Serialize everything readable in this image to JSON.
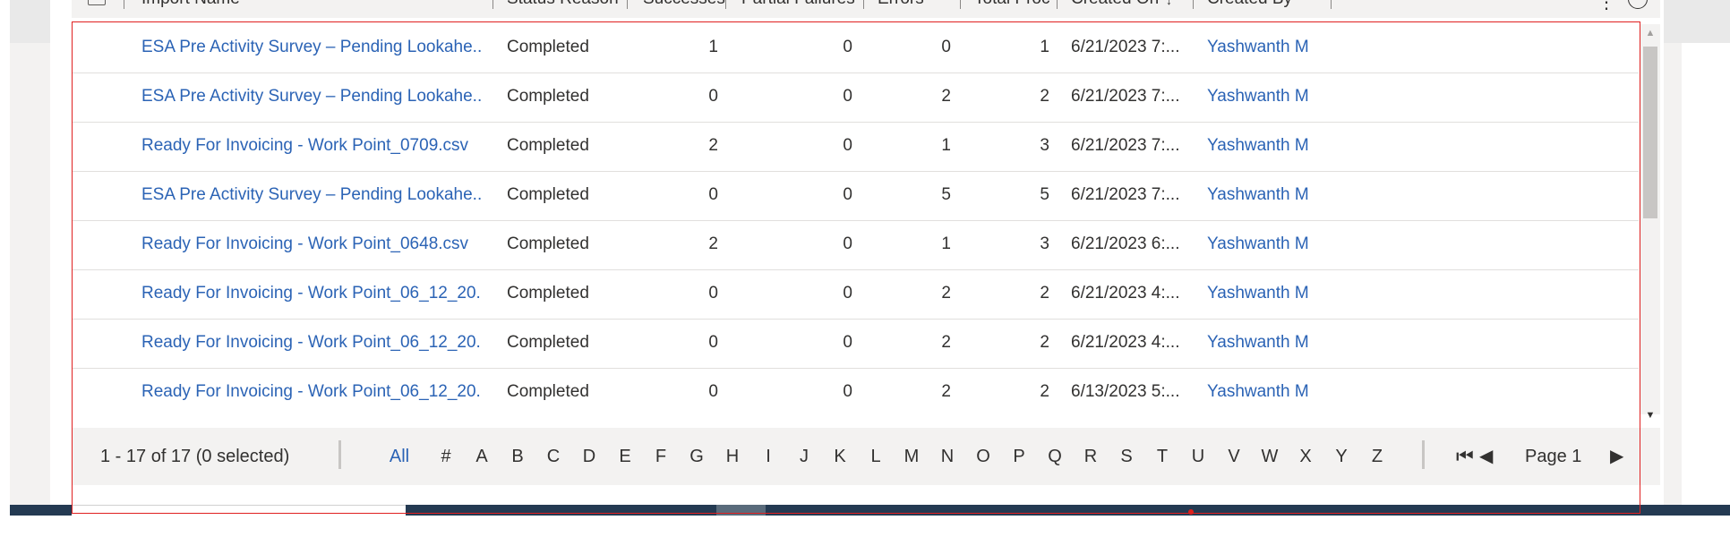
{
  "header": {
    "columns": [
      "Import Name",
      "Status Reason",
      "Successes",
      "Partial Failures",
      "Errors",
      "Total Proc",
      "Created On",
      "Created By"
    ]
  },
  "rows": [
    {
      "name": "ESA Pre Activity Survey – Pending Lookahe...",
      "status": "Completed",
      "successes": "1",
      "partial": "0",
      "errors": "0",
      "total": "1",
      "created_on": "6/21/2023 7:...",
      "created_by": "Yashwanth M"
    },
    {
      "name": "ESA Pre Activity Survey – Pending Lookahe...",
      "status": "Completed",
      "successes": "0",
      "partial": "0",
      "errors": "2",
      "total": "2",
      "created_on": "6/21/2023 7:...",
      "created_by": "Yashwanth M"
    },
    {
      "name": "Ready For Invoicing - Work Point_0709.csv",
      "status": "Completed",
      "successes": "2",
      "partial": "0",
      "errors": "1",
      "total": "3",
      "created_on": "6/21/2023 7:...",
      "created_by": "Yashwanth M"
    },
    {
      "name": "ESA Pre Activity Survey – Pending Lookahe...",
      "status": "Completed",
      "successes": "0",
      "partial": "0",
      "errors": "5",
      "total": "5",
      "created_on": "6/21/2023 7:...",
      "created_by": "Yashwanth M"
    },
    {
      "name": "Ready For Invoicing - Work Point_0648.csv",
      "status": "Completed",
      "successes": "2",
      "partial": "0",
      "errors": "1",
      "total": "3",
      "created_on": "6/21/2023 6:...",
      "created_by": "Yashwanth M"
    },
    {
      "name": "Ready For Invoicing - Work Point_06_12_20...",
      "status": "Completed",
      "successes": "0",
      "partial": "0",
      "errors": "2",
      "total": "2",
      "created_on": "6/21/2023 4:...",
      "created_by": "Yashwanth M"
    },
    {
      "name": "Ready For Invoicing - Work Point_06_12_20...",
      "status": "Completed",
      "successes": "0",
      "partial": "0",
      "errors": "2",
      "total": "2",
      "created_on": "6/21/2023 4:...",
      "created_by": "Yashwanth M"
    },
    {
      "name": "Ready For Invoicing - Work Point_06_12_20...",
      "status": "Completed",
      "successes": "0",
      "partial": "0",
      "errors": "2",
      "total": "2",
      "created_on": "6/13/2023 5:...",
      "created_by": "Yashwanth M"
    }
  ],
  "footer": {
    "record_count": "1 - 17 of 17 (0 selected)",
    "jump_all": "All",
    "jump_letters": [
      "#",
      "A",
      "B",
      "C",
      "D",
      "E",
      "F",
      "G",
      "H",
      "I",
      "J",
      "K",
      "L",
      "M",
      "N",
      "O",
      "P",
      "Q",
      "R",
      "S",
      "T",
      "U",
      "V",
      "W",
      "X",
      "Y",
      "Z"
    ],
    "page_label": "Page 1"
  },
  "icons": {
    "first_page": "first-page-icon",
    "prev_page": "previous-page-icon",
    "next_page": "next-page-icon",
    "sort": "sort-descending-icon"
  },
  "colors": {
    "link": "#2b63b5",
    "highlight_border": "#e02020"
  }
}
